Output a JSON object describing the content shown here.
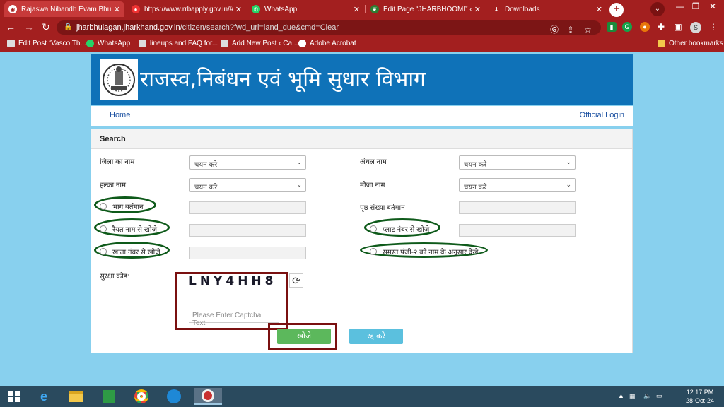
{
  "browser": {
    "tabs": [
      {
        "title": "Rajaswa Nibandh Evam Bhumi",
        "icon": "globe-icon",
        "active": true
      },
      {
        "title": "https://www.rrbapply.gov.in/#/",
        "icon": "rrb-icon",
        "active": false
      },
      {
        "title": "WhatsApp",
        "icon": "whatsapp-icon",
        "active": false
      },
      {
        "title": "Edit Page “JHARBHOOMI” ‹ JH",
        "icon": "leaf-icon",
        "active": false
      },
      {
        "title": "Downloads",
        "icon": "download-icon",
        "active": false
      }
    ],
    "url_host": "jharbhulagan.jharkhand.gov.in",
    "url_path": "/citizen/search?fwd_url=land_due&cmd=Clear",
    "profile_initial": "S",
    "bookmarks": [
      {
        "label": "Edit Post “Vasco Th...",
        "icon": "wp-icon"
      },
      {
        "label": "WhatsApp",
        "icon": "whatsapp-icon"
      },
      {
        "label": "lineups and FAQ for...",
        "icon": "wp-icon"
      },
      {
        "label": "Add New Post ‹ Ca...",
        "icon": "wp-icon"
      },
      {
        "label": "Adobe Acrobat",
        "icon": "acrobat-icon"
      }
    ],
    "other_bookmarks": "Other bookmarks"
  },
  "site": {
    "title": "राजस्व,निबंधन एवं भूमि सुधार विभाग",
    "nav_home": "Home",
    "nav_login": "Official Login"
  },
  "form": {
    "panel_title": "Search",
    "district_label": "जिला का नाम",
    "district_value": "चयन करे",
    "anchal_label": "अंचल नाम",
    "anchal_value": "चयन करे",
    "halka_label": "हल्का नाम",
    "halka_value": "चयन करे",
    "mauja_label": "मौजा नाम",
    "mauja_value": "चयन करे",
    "radio_bhag": "भाग बर्तमान",
    "page_label": "पृष्ठ संख्या बर्तमान",
    "radio_raiyat": "रैयत नाम से खोजे",
    "radio_plot": "प्लाट नंबर से खोजे",
    "radio_khata": "खाता नंबर से खोजे",
    "radio_panji": "समस्त पंजी-२ को नाम के अनुसार देखे",
    "captcha_label": "सुरक्षा कोड:",
    "captcha_code": "LNY4HH8",
    "captcha_placeholder": "Please Enter Captcha Text",
    "search_button": "खोजे",
    "cancel_button": "रद्द करे"
  },
  "taskbar": {
    "time": "12:17 PM",
    "date": "28-Oct-24"
  },
  "colors": {
    "chrome_red": "#a31f1f",
    "page_bg": "#88d0ee",
    "banner_blue": "#0f72b8",
    "search_green": "#5cb85c",
    "cancel_blue": "#5bc0de",
    "highlight_green": "#0e5a1a",
    "highlight_red": "#7a1010"
  }
}
